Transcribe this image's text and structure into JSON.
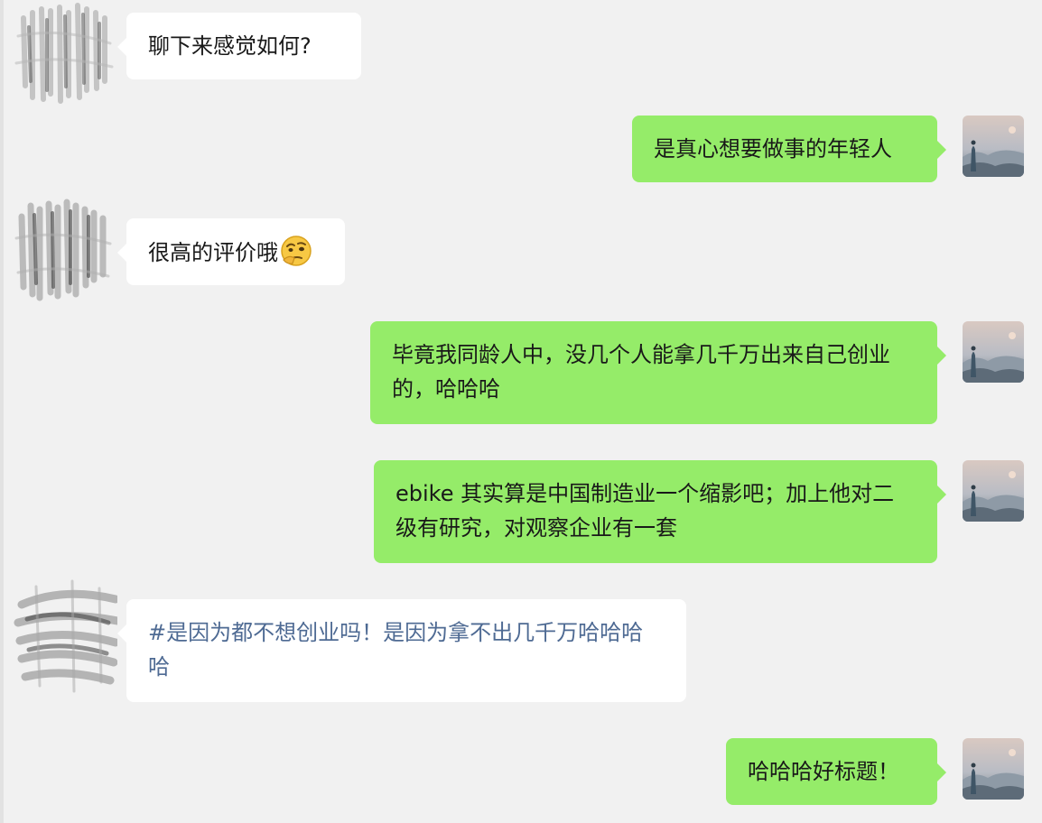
{
  "messages": [
    {
      "side": "incoming",
      "text": "聊下来感觉如何?"
    },
    {
      "side": "outgoing",
      "text": "是真心想要做事的年轻人"
    },
    {
      "side": "incoming",
      "text": "很高的评价哦",
      "emoji": "thinking-face-emoji"
    },
    {
      "side": "outgoing",
      "text": "毕竟我同龄人中，没几个人能拿几千万出来自己创业的，哈哈哈"
    },
    {
      "side": "outgoing",
      "text": "ebike 其实算是中国制造业一个缩影吧；加上他对二级有研究，对观察企业有一套"
    },
    {
      "side": "incoming",
      "text": "#是因为都不想创业吗！是因为拿不出几千万哈哈哈哈",
      "style": "hashtag"
    },
    {
      "side": "outgoing",
      "text": "哈哈哈好标题！"
    }
  ],
  "colors": {
    "background": "#f1f1f1",
    "incoming_bubble": "#ffffff",
    "outgoing_bubble": "#95ec69",
    "hashtag_text": "#4e6a93",
    "text": "#191919"
  }
}
